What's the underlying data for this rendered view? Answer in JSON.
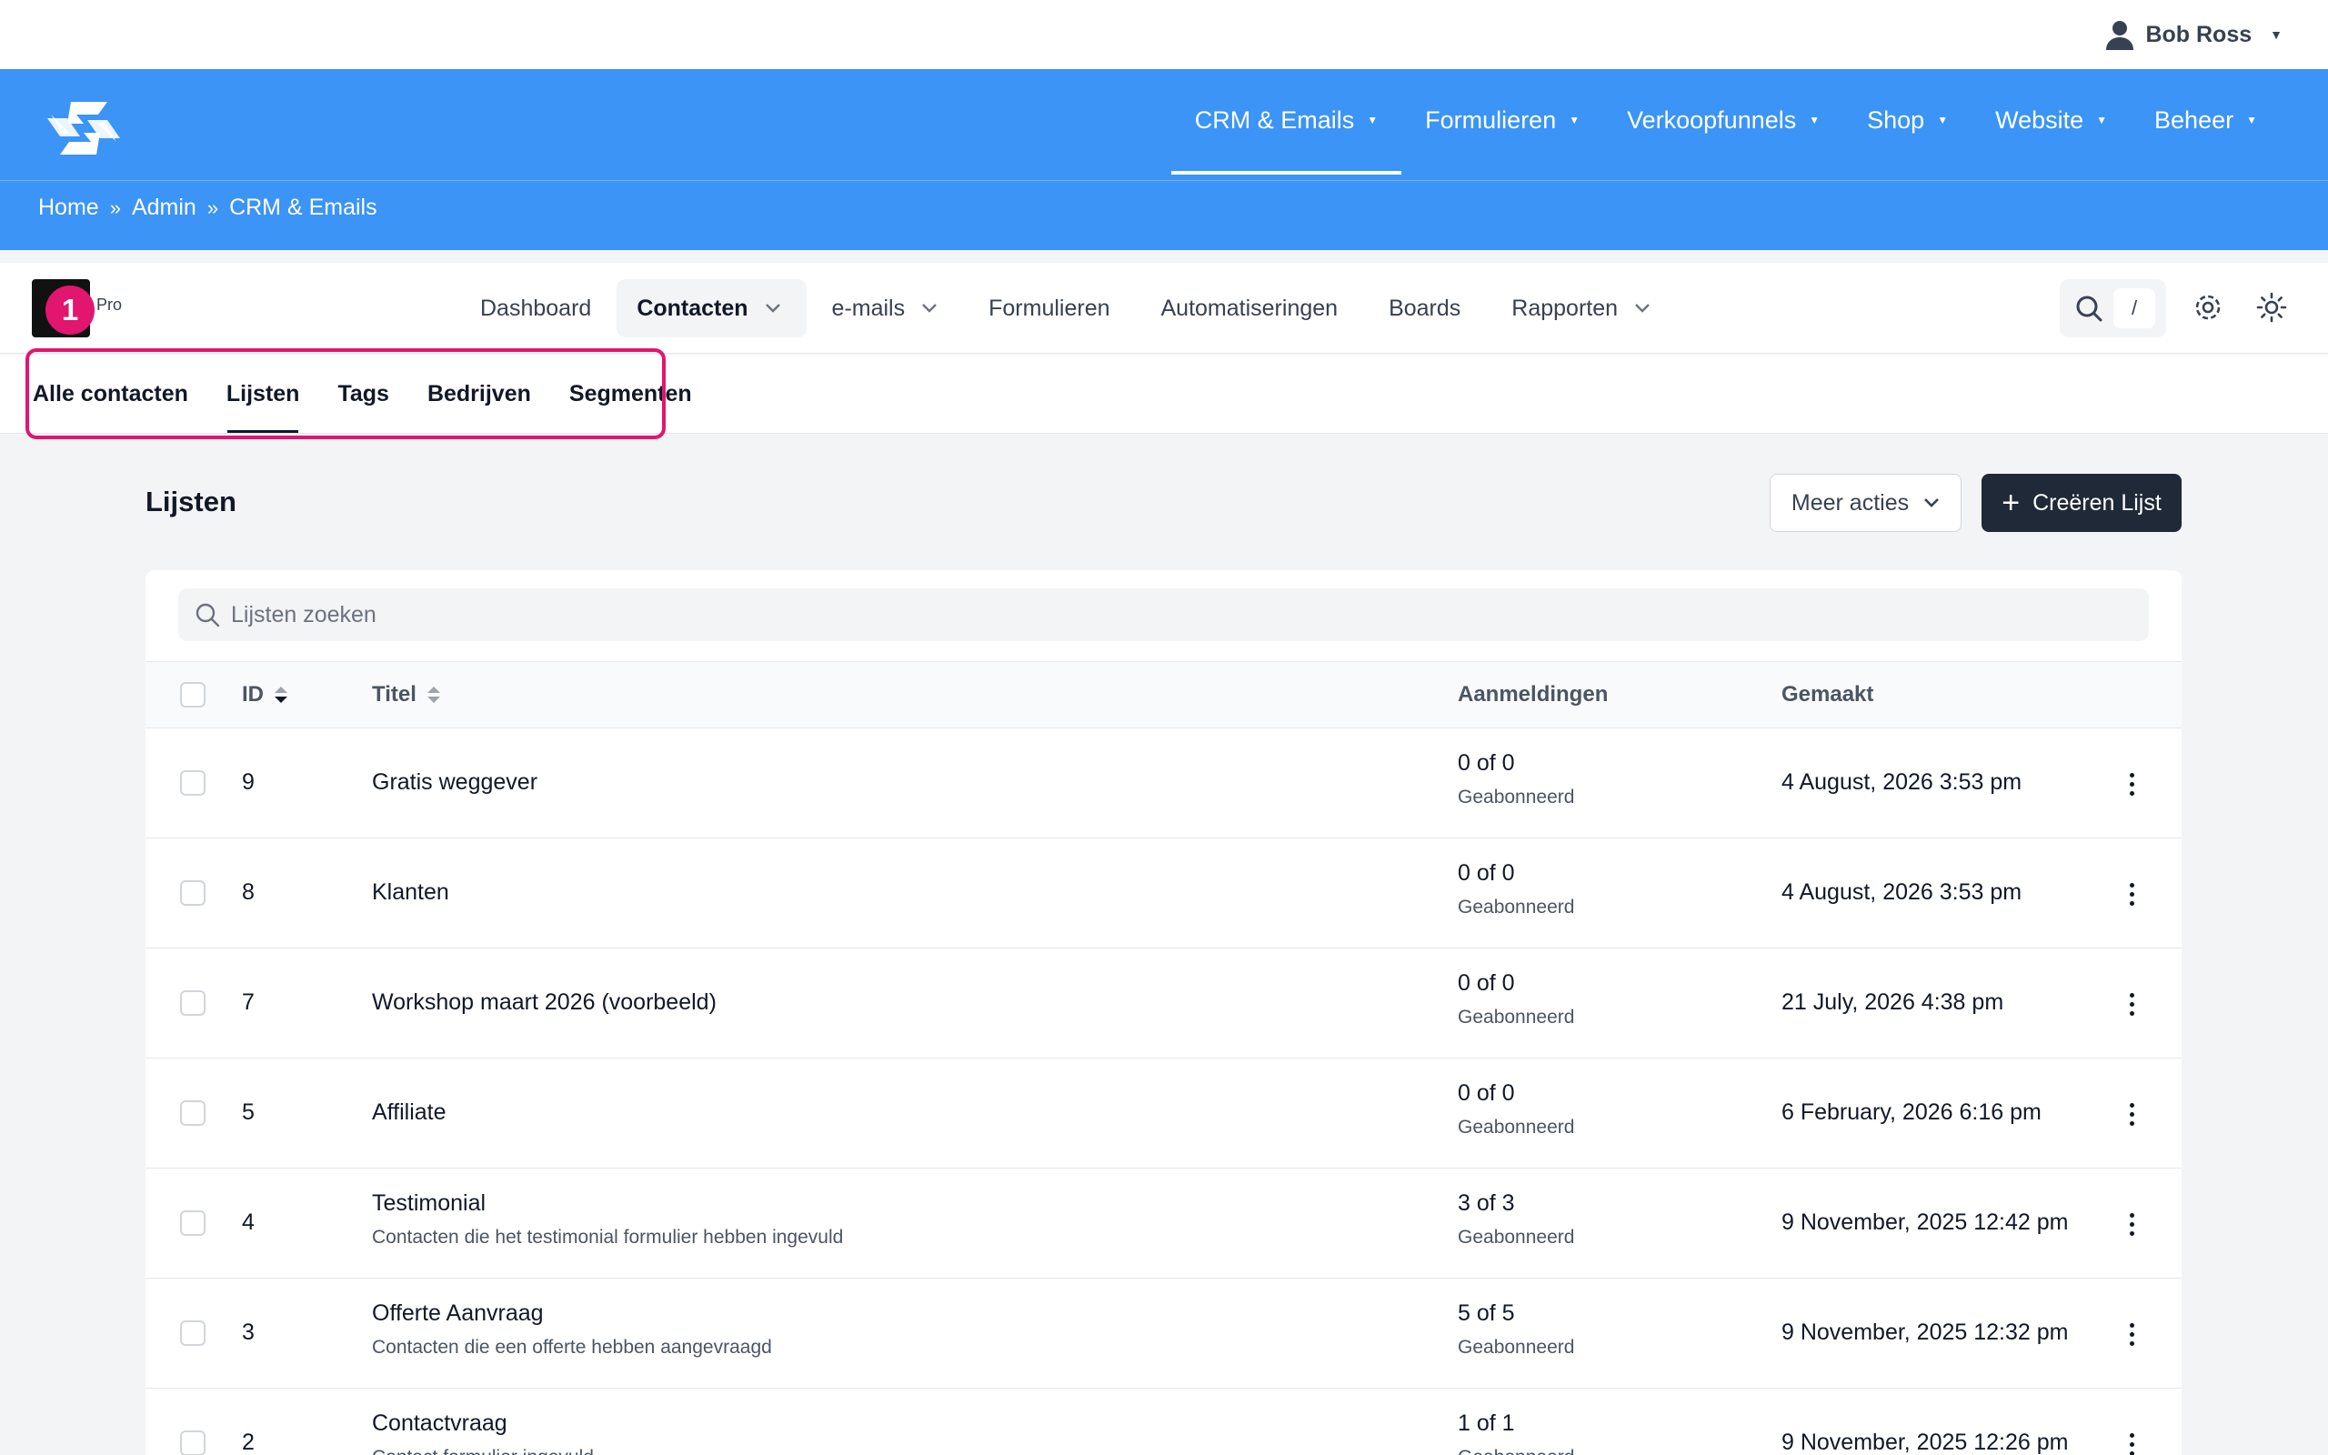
{
  "user": {
    "name": "Bob Ross"
  },
  "main_nav": [
    {
      "label": "CRM & Emails",
      "active": true
    },
    {
      "label": "Formulieren"
    },
    {
      "label": "Verkoopfunnels"
    },
    {
      "label": "Shop"
    },
    {
      "label": "Website"
    },
    {
      "label": "Beheer"
    }
  ],
  "breadcrumb": [
    "Home",
    "Admin",
    "CRM & Emails"
  ],
  "breadcrumb_sep": "»",
  "app": {
    "badge": "1",
    "edition": "Pro"
  },
  "app_nav": [
    {
      "label": "Dashboard"
    },
    {
      "label": "Contacten",
      "active": true,
      "dropdown": true
    },
    {
      "label": "e-mails",
      "dropdown": true
    },
    {
      "label": "Formulieren"
    },
    {
      "label": "Automatiseringen"
    },
    {
      "label": "Boards"
    },
    {
      "label": "Rapporten",
      "dropdown": true
    }
  ],
  "search_shortcut": "/",
  "sub_tabs": [
    {
      "label": "Alle contacten"
    },
    {
      "label": "Lijsten",
      "active": true
    },
    {
      "label": "Tags"
    },
    {
      "label": "Bedrijven"
    },
    {
      "label": "Segmenten"
    }
  ],
  "page": {
    "title": "Lijsten",
    "more_actions": "Meer acties",
    "create": "Creëren Lijst",
    "search_placeholder": "Lijsten zoeken"
  },
  "table": {
    "columns": {
      "id": "ID",
      "title": "Titel",
      "signups": "Aanmeldingen",
      "created": "Gemaakt"
    },
    "rows": [
      {
        "id": "9",
        "title": "Gratis weggever",
        "description": "",
        "signups": "0 of 0",
        "status": "Geabonneerd",
        "created": "4 August, 2026 3:53 pm"
      },
      {
        "id": "8",
        "title": "Klanten",
        "description": "",
        "signups": "0 of 0",
        "status": "Geabonneerd",
        "created": "4 August, 2026 3:53 pm"
      },
      {
        "id": "7",
        "title": "Workshop maart 2026 (voorbeeld)",
        "description": "",
        "signups": "0 of 0",
        "status": "Geabonneerd",
        "created": "21 July, 2026 4:38 pm"
      },
      {
        "id": "5",
        "title": "Affiliate",
        "description": "",
        "signups": "0 of 0",
        "status": "Geabonneerd",
        "created": "6 February, 2026 6:16 pm"
      },
      {
        "id": "4",
        "title": "Testimonial",
        "description": "Contacten die het testimonial formulier hebben ingevuld",
        "signups": "3 of 3",
        "status": "Geabonneerd",
        "created": "9 November, 2025 12:42 pm"
      },
      {
        "id": "3",
        "title": "Offerte Aanvraag",
        "description": "Contacten die een offerte hebben aangevraagd",
        "signups": "5 of 5",
        "status": "Geabonneerd",
        "created": "9 November, 2025 12:32 pm"
      },
      {
        "id": "2",
        "title": "Contactvraag",
        "description": "Contact formulier ingevuld",
        "signups": "1 of 1",
        "status": "Geabonneerd",
        "created": "9 November, 2025 12:26 pm"
      }
    ]
  }
}
